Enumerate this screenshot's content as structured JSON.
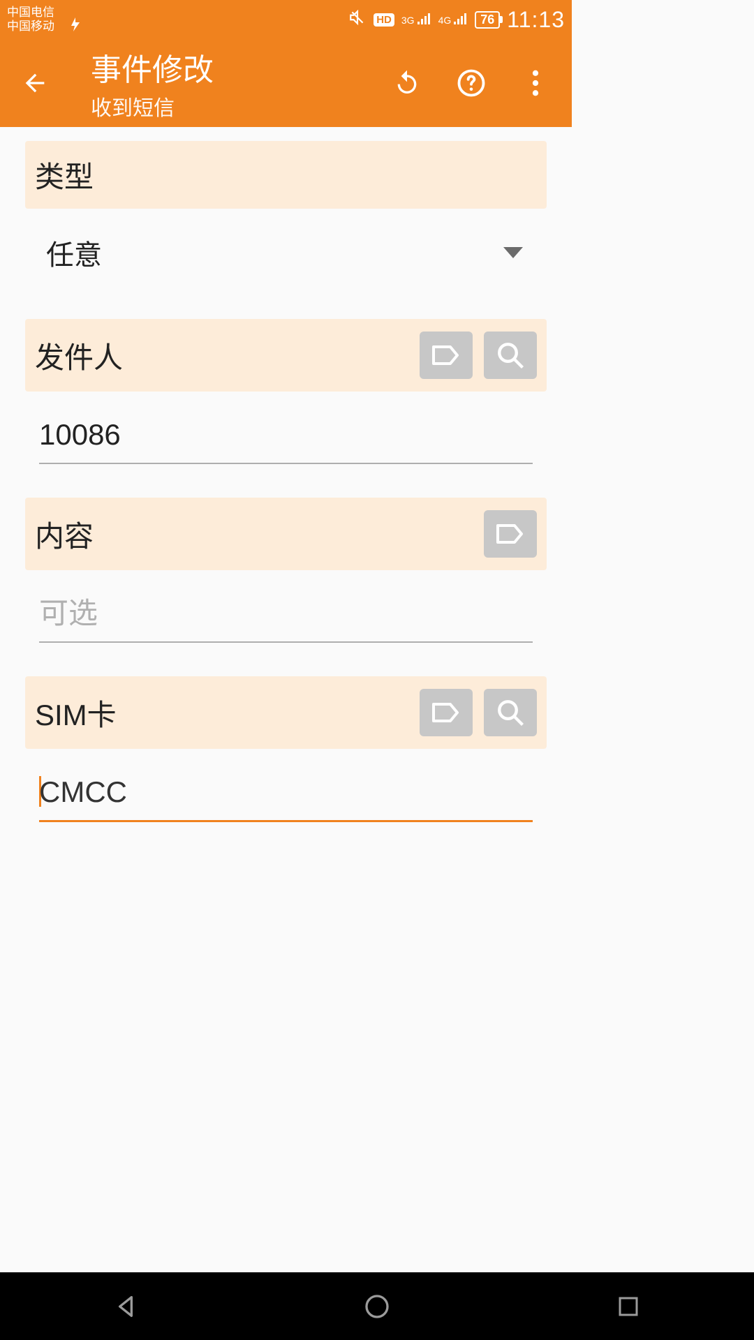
{
  "status": {
    "carrier1": "中国电信",
    "carrier2": "中国移动",
    "sig1": "3G",
    "sig2": "4G",
    "hd": "HD",
    "battery": "76",
    "time": "11:13"
  },
  "appbar": {
    "title": "事件修改",
    "subtitle": "收到短信"
  },
  "sections": {
    "type": {
      "label": "类型",
      "value": "任意"
    },
    "sender": {
      "label": "发件人",
      "value": "10086"
    },
    "content": {
      "label": "内容",
      "placeholder": "可选",
      "value": ""
    },
    "sim": {
      "label": "SIM卡",
      "value": "CMCC"
    }
  },
  "colors": {
    "accent": "#f0821e",
    "section_bg": "#fdecd9",
    "btn_gray": "#c7c7c7"
  }
}
